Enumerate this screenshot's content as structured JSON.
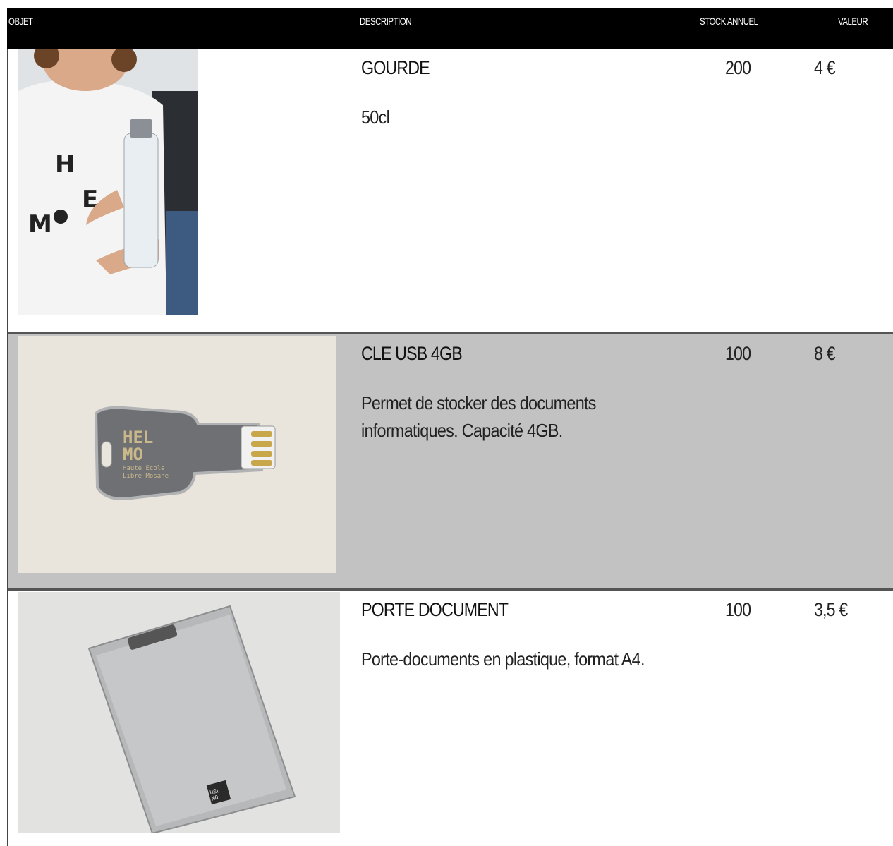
{
  "header": {
    "col_object": "OBJET",
    "col_description": "DESCRIPTION",
    "col_stock": "STOCK ANNUEL",
    "col_value": "VALEUR"
  },
  "items": [
    {
      "name": "GOURDE",
      "description": "50cl",
      "stock": "200",
      "value": "4 €",
      "image": "water-bottle-photo"
    },
    {
      "name": "CLE USB 4GB",
      "description": "Permet de stocker des documents informatiques. Capacité 4GB.",
      "stock": "100",
      "value": "8 €",
      "image": "usb-key-photo",
      "logo_text": [
        "HEL",
        "MO",
        "Haute Ecole",
        "Libre Mosane"
      ]
    },
    {
      "name": "PORTE DOCUMENT",
      "description": "Porte-documents en plastique, format A4.",
      "stock": "100",
      "value": "3,5 €",
      "image": "clipboard-photo",
      "logo_text": [
        "HEL",
        "MO"
      ]
    }
  ],
  "colors": {
    "header_bg": "#000000",
    "alt_row_bg": "#c2c2c2"
  }
}
